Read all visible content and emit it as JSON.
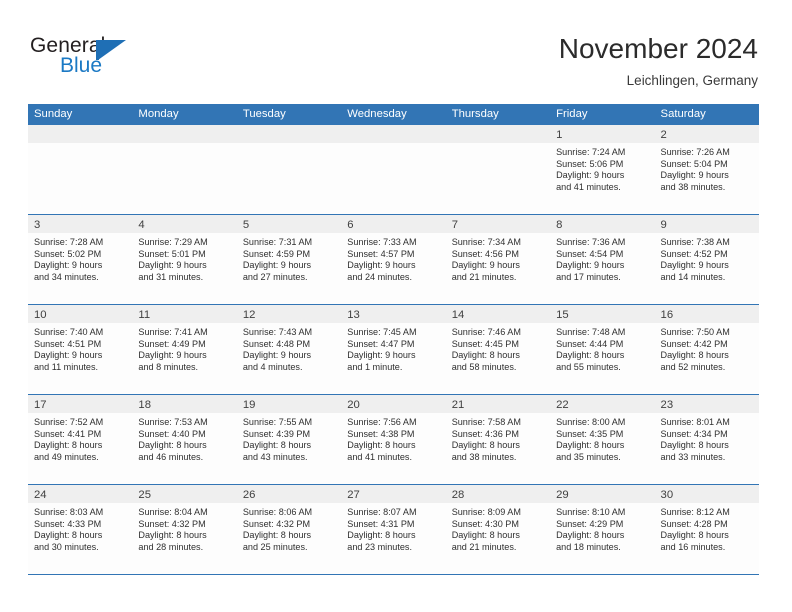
{
  "brand": {
    "name_part1": "General",
    "name_part2": "Blue",
    "logo_icon": "blue-triangle-logo",
    "accent_color": "#1f6fb5"
  },
  "header": {
    "title": "November 2024",
    "subtitle": "Leichlingen, Germany"
  },
  "colors": {
    "header_blue": "#3275b5",
    "day_band_gray": "#efefef",
    "text_dark": "#2f2f2f"
  },
  "calendar": {
    "day_headers": [
      "Sunday",
      "Monday",
      "Tuesday",
      "Wednesday",
      "Thursday",
      "Friday",
      "Saturday"
    ],
    "weeks": [
      [
        {
          "empty": true
        },
        {
          "empty": true
        },
        {
          "empty": true
        },
        {
          "empty": true
        },
        {
          "empty": true
        },
        {
          "day": "1",
          "sunrise": "Sunrise: 7:24 AM",
          "sunset": "Sunset: 5:06 PM",
          "daylight_1": "Daylight: 9 hours",
          "daylight_2": "and 41 minutes."
        },
        {
          "day": "2",
          "sunrise": "Sunrise: 7:26 AM",
          "sunset": "Sunset: 5:04 PM",
          "daylight_1": "Daylight: 9 hours",
          "daylight_2": "and 38 minutes."
        }
      ],
      [
        {
          "day": "3",
          "sunrise": "Sunrise: 7:28 AM",
          "sunset": "Sunset: 5:02 PM",
          "daylight_1": "Daylight: 9 hours",
          "daylight_2": "and 34 minutes."
        },
        {
          "day": "4",
          "sunrise": "Sunrise: 7:29 AM",
          "sunset": "Sunset: 5:01 PM",
          "daylight_1": "Daylight: 9 hours",
          "daylight_2": "and 31 minutes."
        },
        {
          "day": "5",
          "sunrise": "Sunrise: 7:31 AM",
          "sunset": "Sunset: 4:59 PM",
          "daylight_1": "Daylight: 9 hours",
          "daylight_2": "and 27 minutes."
        },
        {
          "day": "6",
          "sunrise": "Sunrise: 7:33 AM",
          "sunset": "Sunset: 4:57 PM",
          "daylight_1": "Daylight: 9 hours",
          "daylight_2": "and 24 minutes."
        },
        {
          "day": "7",
          "sunrise": "Sunrise: 7:34 AM",
          "sunset": "Sunset: 4:56 PM",
          "daylight_1": "Daylight: 9 hours",
          "daylight_2": "and 21 minutes."
        },
        {
          "day": "8",
          "sunrise": "Sunrise: 7:36 AM",
          "sunset": "Sunset: 4:54 PM",
          "daylight_1": "Daylight: 9 hours",
          "daylight_2": "and 17 minutes."
        },
        {
          "day": "9",
          "sunrise": "Sunrise: 7:38 AM",
          "sunset": "Sunset: 4:52 PM",
          "daylight_1": "Daylight: 9 hours",
          "daylight_2": "and 14 minutes."
        }
      ],
      [
        {
          "day": "10",
          "sunrise": "Sunrise: 7:40 AM",
          "sunset": "Sunset: 4:51 PM",
          "daylight_1": "Daylight: 9 hours",
          "daylight_2": "and 11 minutes."
        },
        {
          "day": "11",
          "sunrise": "Sunrise: 7:41 AM",
          "sunset": "Sunset: 4:49 PM",
          "daylight_1": "Daylight: 9 hours",
          "daylight_2": "and 8 minutes."
        },
        {
          "day": "12",
          "sunrise": "Sunrise: 7:43 AM",
          "sunset": "Sunset: 4:48 PM",
          "daylight_1": "Daylight: 9 hours",
          "daylight_2": "and 4 minutes."
        },
        {
          "day": "13",
          "sunrise": "Sunrise: 7:45 AM",
          "sunset": "Sunset: 4:47 PM",
          "daylight_1": "Daylight: 9 hours",
          "daylight_2": "and 1 minute."
        },
        {
          "day": "14",
          "sunrise": "Sunrise: 7:46 AM",
          "sunset": "Sunset: 4:45 PM",
          "daylight_1": "Daylight: 8 hours",
          "daylight_2": "and 58 minutes."
        },
        {
          "day": "15",
          "sunrise": "Sunrise: 7:48 AM",
          "sunset": "Sunset: 4:44 PM",
          "daylight_1": "Daylight: 8 hours",
          "daylight_2": "and 55 minutes."
        },
        {
          "day": "16",
          "sunrise": "Sunrise: 7:50 AM",
          "sunset": "Sunset: 4:42 PM",
          "daylight_1": "Daylight: 8 hours",
          "daylight_2": "and 52 minutes."
        }
      ],
      [
        {
          "day": "17",
          "sunrise": "Sunrise: 7:52 AM",
          "sunset": "Sunset: 4:41 PM",
          "daylight_1": "Daylight: 8 hours",
          "daylight_2": "and 49 minutes."
        },
        {
          "day": "18",
          "sunrise": "Sunrise: 7:53 AM",
          "sunset": "Sunset: 4:40 PM",
          "daylight_1": "Daylight: 8 hours",
          "daylight_2": "and 46 minutes."
        },
        {
          "day": "19",
          "sunrise": "Sunrise: 7:55 AM",
          "sunset": "Sunset: 4:39 PM",
          "daylight_1": "Daylight: 8 hours",
          "daylight_2": "and 43 minutes."
        },
        {
          "day": "20",
          "sunrise": "Sunrise: 7:56 AM",
          "sunset": "Sunset: 4:38 PM",
          "daylight_1": "Daylight: 8 hours",
          "daylight_2": "and 41 minutes."
        },
        {
          "day": "21",
          "sunrise": "Sunrise: 7:58 AM",
          "sunset": "Sunset: 4:36 PM",
          "daylight_1": "Daylight: 8 hours",
          "daylight_2": "and 38 minutes."
        },
        {
          "day": "22",
          "sunrise": "Sunrise: 8:00 AM",
          "sunset": "Sunset: 4:35 PM",
          "daylight_1": "Daylight: 8 hours",
          "daylight_2": "and 35 minutes."
        },
        {
          "day": "23",
          "sunrise": "Sunrise: 8:01 AM",
          "sunset": "Sunset: 4:34 PM",
          "daylight_1": "Daylight: 8 hours",
          "daylight_2": "and 33 minutes."
        }
      ],
      [
        {
          "day": "24",
          "sunrise": "Sunrise: 8:03 AM",
          "sunset": "Sunset: 4:33 PM",
          "daylight_1": "Daylight: 8 hours",
          "daylight_2": "and 30 minutes."
        },
        {
          "day": "25",
          "sunrise": "Sunrise: 8:04 AM",
          "sunset": "Sunset: 4:32 PM",
          "daylight_1": "Daylight: 8 hours",
          "daylight_2": "and 28 minutes."
        },
        {
          "day": "26",
          "sunrise": "Sunrise: 8:06 AM",
          "sunset": "Sunset: 4:32 PM",
          "daylight_1": "Daylight: 8 hours",
          "daylight_2": "and 25 minutes."
        },
        {
          "day": "27",
          "sunrise": "Sunrise: 8:07 AM",
          "sunset": "Sunset: 4:31 PM",
          "daylight_1": "Daylight: 8 hours",
          "daylight_2": "and 23 minutes."
        },
        {
          "day": "28",
          "sunrise": "Sunrise: 8:09 AM",
          "sunset": "Sunset: 4:30 PM",
          "daylight_1": "Daylight: 8 hours",
          "daylight_2": "and 21 minutes."
        },
        {
          "day": "29",
          "sunrise": "Sunrise: 8:10 AM",
          "sunset": "Sunset: 4:29 PM",
          "daylight_1": "Daylight: 8 hours",
          "daylight_2": "and 18 minutes."
        },
        {
          "day": "30",
          "sunrise": "Sunrise: 8:12 AM",
          "sunset": "Sunset: 4:28 PM",
          "daylight_1": "Daylight: 8 hours",
          "daylight_2": "and 16 minutes."
        }
      ]
    ]
  }
}
